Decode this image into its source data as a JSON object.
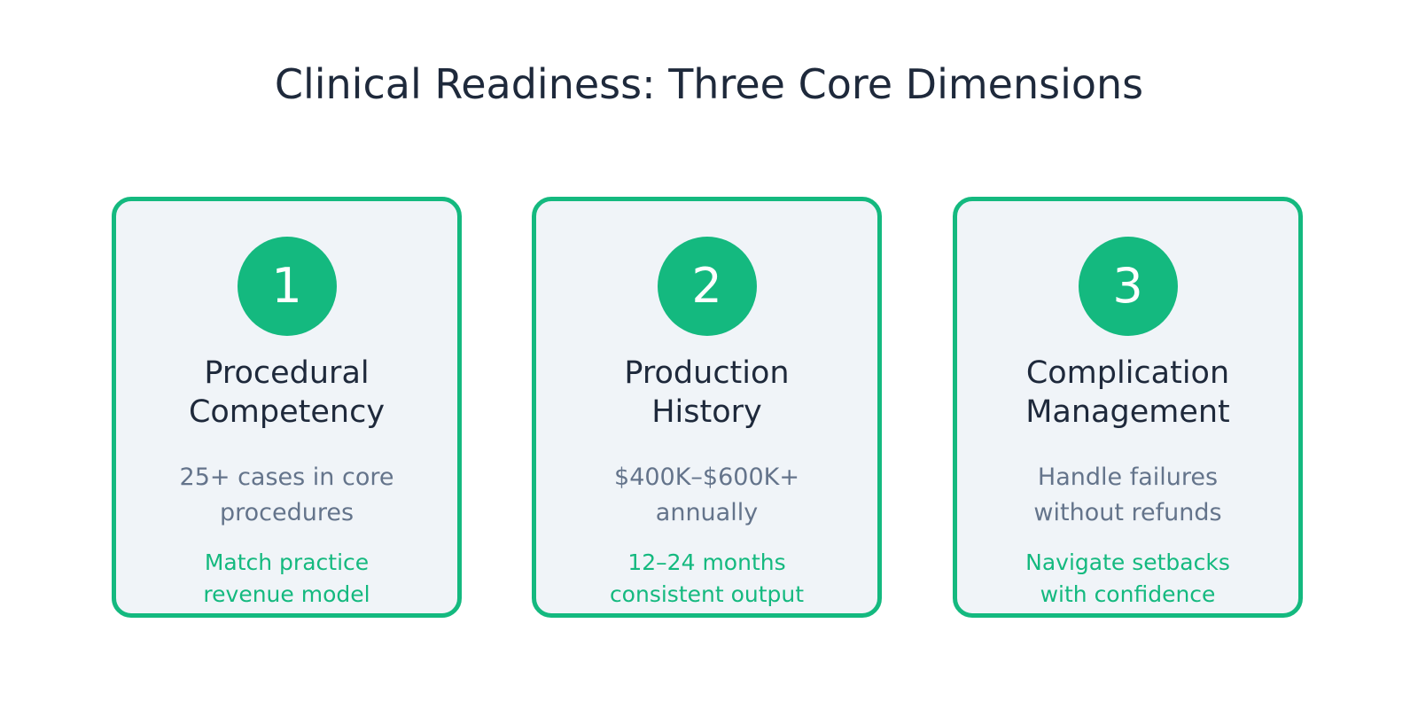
{
  "title": "Clinical Readiness: Three Core Dimensions",
  "accent_color": "#14b97f",
  "card_background": "#f0f4f8",
  "cards": [
    {
      "number": "1",
      "title_lines": [
        "Procedural",
        "Competency"
      ],
      "description_lines": [
        "25+ cases in core",
        "procedures"
      ],
      "note_lines": [
        "Match practice",
        "revenue model"
      ]
    },
    {
      "number": "2",
      "title_lines": [
        "Production",
        "History"
      ],
      "description_lines": [
        "$400K–$600K+",
        "annually"
      ],
      "note_lines": [
        "12–24 months",
        "consistent output"
      ]
    },
    {
      "number": "3",
      "title_lines": [
        "Complication",
        "Management"
      ],
      "description_lines": [
        "Handle failures",
        "without refunds"
      ],
      "note_lines": [
        "Navigate setbacks",
        "with confidence"
      ]
    }
  ]
}
